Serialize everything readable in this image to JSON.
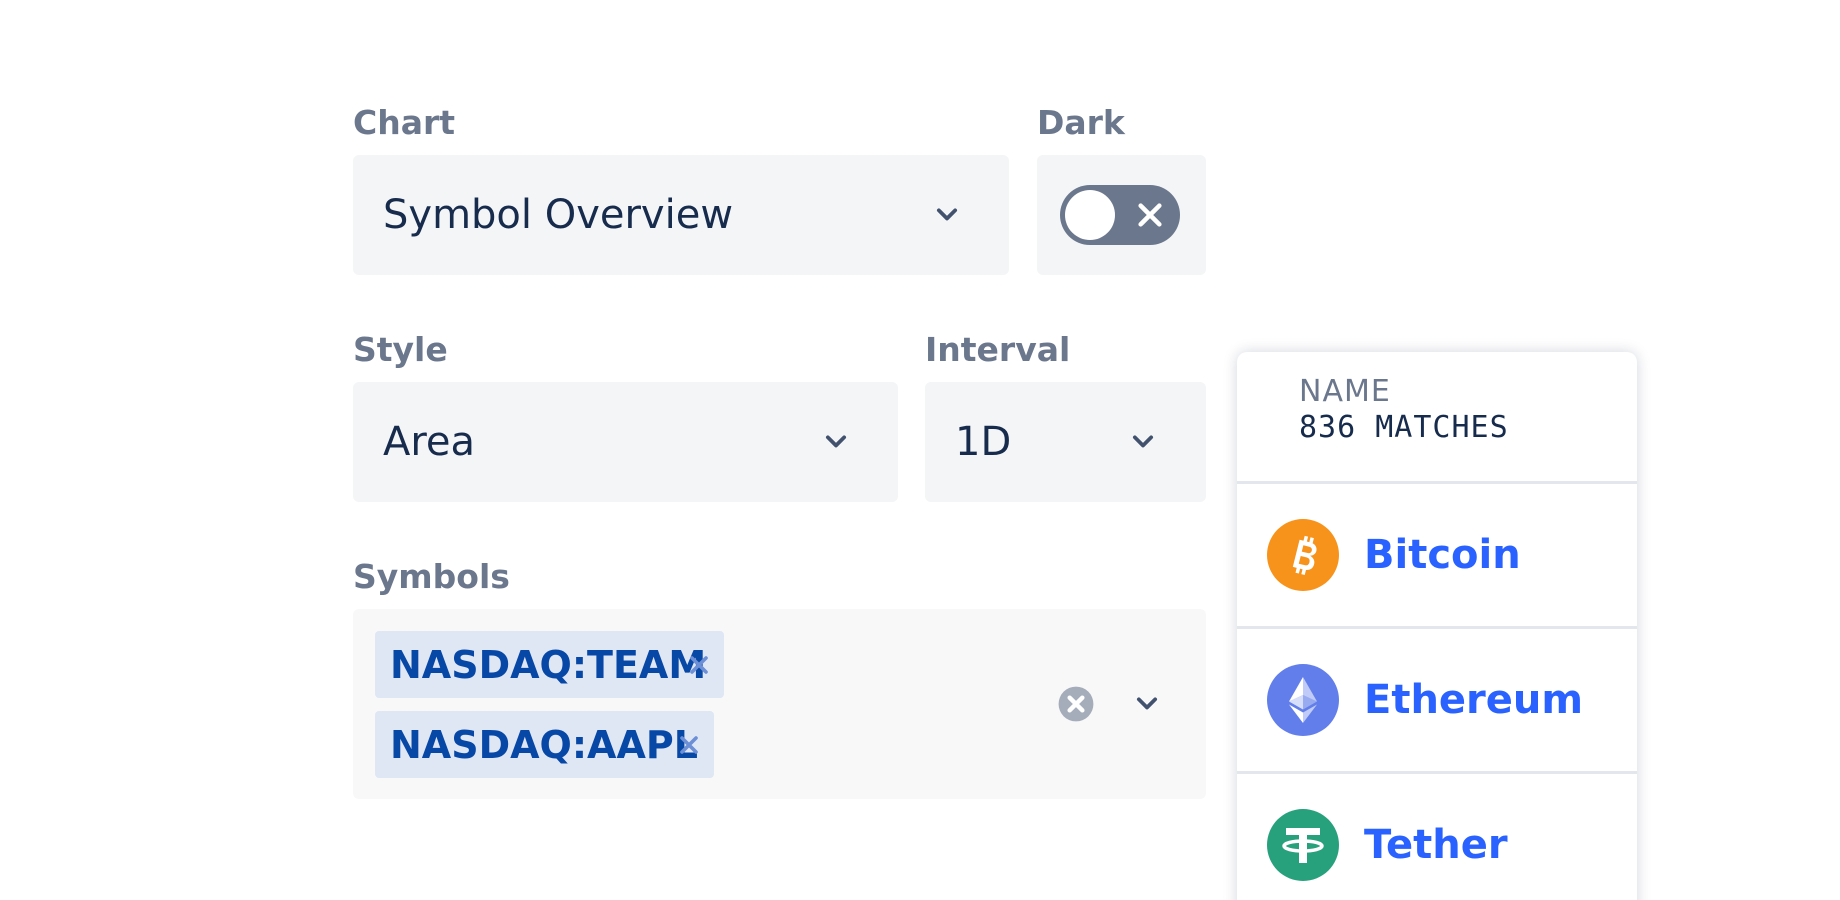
{
  "form": {
    "chart": {
      "label": "Chart",
      "value": "Symbol Overview"
    },
    "dark": {
      "label": "Dark",
      "enabled": false
    },
    "style": {
      "label": "Style",
      "value": "Area"
    },
    "interval": {
      "label": "Interval",
      "value": "1D"
    },
    "symbols": {
      "label": "Symbols",
      "tags": [
        "NASDAQ:TEAM",
        "NASDAQ:AAPL"
      ]
    }
  },
  "dropdown": {
    "column": "NAME",
    "count": "836 MATCHES",
    "items": [
      {
        "name": "Bitcoin",
        "icon": "bitcoin-icon",
        "color": "#f7931a"
      },
      {
        "name": "Ethereum",
        "icon": "ethereum-icon",
        "color": "#627eea"
      },
      {
        "name": "Tether",
        "icon": "tether-icon",
        "color": "#26a17b"
      }
    ]
  },
  "colors": {
    "label": "#6b778c",
    "field_bg": "#f4f5f7",
    "tag_bg": "#dfe7f5",
    "tag_text": "#0747a6",
    "link": "#2962ff"
  }
}
